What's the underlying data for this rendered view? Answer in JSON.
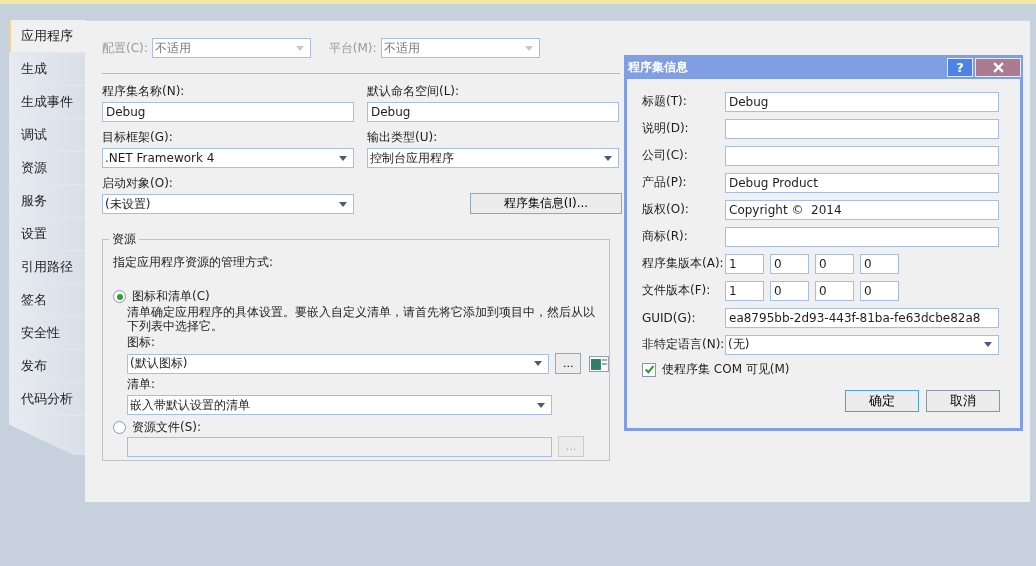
{
  "tabs": [
    {
      "label": "应用程序",
      "selected": true
    },
    {
      "label": "生成",
      "selected": false
    },
    {
      "label": "生成事件",
      "selected": false
    },
    {
      "label": "调试",
      "selected": false
    },
    {
      "label": "资源",
      "selected": false
    },
    {
      "label": "服务",
      "selected": false
    },
    {
      "label": "设置",
      "selected": false
    },
    {
      "label": "引用路径",
      "selected": false
    },
    {
      "label": "签名",
      "selected": false
    },
    {
      "label": "安全性",
      "selected": false
    },
    {
      "label": "发布",
      "selected": false
    },
    {
      "label": "代码分析",
      "selected": false
    }
  ],
  "top_selects": [
    {
      "label": "配置(C):",
      "value": "不适用",
      "disabled": true
    },
    {
      "label": "平台(M):",
      "value": "不适用",
      "disabled": true
    }
  ],
  "fields": [
    {
      "kind": "text",
      "label": "程序集名称(N):",
      "value": "Debug"
    },
    {
      "kind": "text",
      "label": "默认命名空间(L):",
      "value": "Debug"
    },
    {
      "kind": "select",
      "label": "目标框架(G):",
      "value": ".NET Framework 4"
    },
    {
      "kind": "select",
      "label": "输出类型(U):",
      "value": "控制台应用程序"
    },
    {
      "kind": "select",
      "label": "启动对象(O):",
      "value": "(未设置)"
    },
    {
      "kind": "button",
      "label": "程序集信息(I)..."
    }
  ],
  "resources": {
    "title": "资源",
    "hint": "指定应用程序资源的管理方式:",
    "icon_option": {
      "label": "图标和清单(C)",
      "selected": true,
      "note": "清单确定应用程序的具体设置。要嵌入自定义清单，请首先将它添加到项目中，然后从以下列表中选择它。",
      "icon_label": "图标:",
      "icon_value": "(默认图标)",
      "browse": "...",
      "manifest_label": "清单:",
      "manifest_value": "嵌入带默认设置的清单"
    },
    "file_option": {
      "label": "资源文件(S):",
      "selected": false,
      "disabled": true,
      "browse": "..."
    }
  },
  "dialog": {
    "title": "程序集信息",
    "help": "?",
    "fields": [
      {
        "kind": "text",
        "label": "标题(T):",
        "value": "Debug"
      },
      {
        "kind": "text",
        "label": "说明(D):"
      },
      {
        "kind": "text",
        "label": "公司(C):"
      },
      {
        "kind": "text",
        "label": "产品(P):",
        "value": "Debug Product"
      },
      {
        "kind": "text",
        "label": "版权(O):",
        "value": "Copyright ©  2014"
      },
      {
        "kind": "text",
        "label": "商标(R):"
      },
      {
        "kind": "version",
        "label": "程序集版本(A):",
        "parts": [
          "1",
          "0",
          "0",
          "0"
        ]
      },
      {
        "kind": "version",
        "label": "文件版本(F):",
        "parts": [
          "1",
          "0",
          "0",
          "0"
        ]
      },
      {
        "kind": "text",
        "label": "GUID(G):",
        "value": "ea8795bb-2d93-443f-81ba-fe63dcbe82a8"
      },
      {
        "kind": "select",
        "label": "非特定语言(N):",
        "value": "(无)"
      }
    ],
    "com_visible": {
      "label": "使程序集 COM 可见(M)",
      "checked": true
    },
    "buttons": [
      {
        "label": "确定",
        "default": true
      },
      {
        "label": "取消",
        "default": false
      }
    ]
  }
}
